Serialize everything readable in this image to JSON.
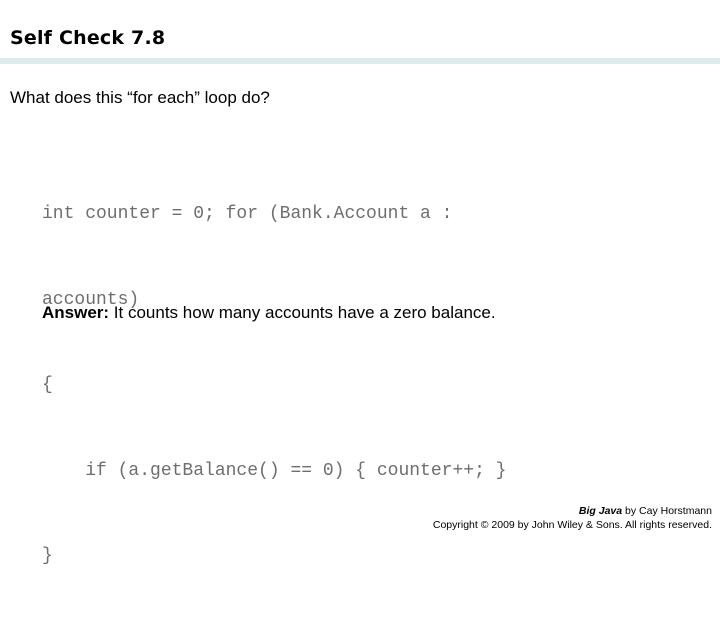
{
  "slide": {
    "title": "Self Check 7.8",
    "question": "What does this “for each” loop do?",
    "rule_color": "#dcebec",
    "code": {
      "color": "#6e6e6e",
      "lines": [
        "int counter = 0; for (Bank.Account a :",
        "accounts)",
        "{",
        "    if (a.getBalance() == 0) { counter++; }",
        "}"
      ]
    },
    "answer": {
      "label": "Answer:",
      "text": " It counts how many accounts have a zero balance."
    },
    "footer": {
      "book_title": "Big Java",
      "byline": " by Cay Horstmann",
      "copyright": "Copyright © 2009 by John Wiley & Sons.  All rights reserved."
    }
  }
}
